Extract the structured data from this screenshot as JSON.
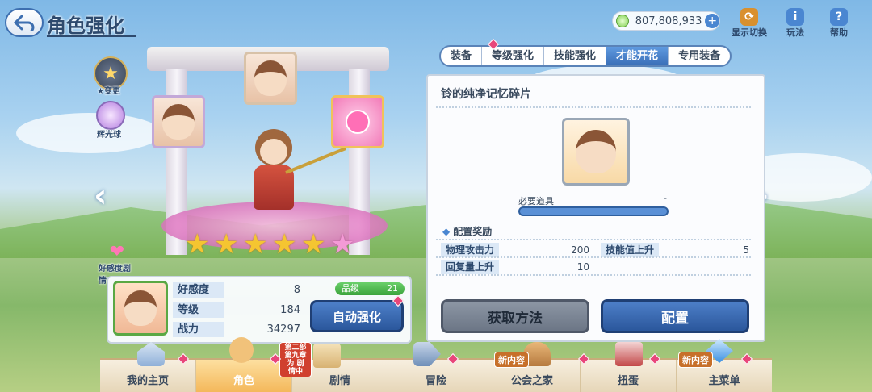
{
  "header": {
    "title": "角色强化",
    "currency_amount": "807,808,933",
    "buttons": [
      {
        "label": "显示切换",
        "icon": "display-toggle-icon"
      },
      {
        "label": "玩法",
        "icon": "info-icon"
      },
      {
        "label": "帮助",
        "icon": "help-icon"
      }
    ]
  },
  "tabs": [
    {
      "label": "装备",
      "active": false
    },
    {
      "label": "等级强化",
      "active": false
    },
    {
      "label": "技能强化",
      "active": false
    },
    {
      "label": "才能开花",
      "active": true
    },
    {
      "label": "专用装备",
      "active": false
    }
  ],
  "side": {
    "star_change_label": "★变更",
    "orb_label": "辉光球",
    "affinity_label": "好感度剧情"
  },
  "character": {
    "star_count": 5,
    "max_stars": 6,
    "stats": [
      {
        "label": "好感度",
        "value": "8"
      },
      {
        "label": "等级",
        "value": "184"
      },
      {
        "label": "战力",
        "value": "34297"
      }
    ],
    "grade_label": "品级",
    "grade_value": "21",
    "auto_button": "自动强化"
  },
  "panel": {
    "title": "铃的纯净记忆碎片",
    "required_label": "必要道具",
    "required_value": "-",
    "reward_header": "配置奖励",
    "rewards": [
      {
        "name": "物理攻击力",
        "value": "200"
      },
      {
        "name": "技能值上升",
        "value": "5"
      },
      {
        "name": "回复量上升",
        "value": "10"
      }
    ],
    "acquire_button": "获取方法",
    "equip_button": "配置"
  },
  "bottom_nav": [
    {
      "label": "我的主页",
      "active": false
    },
    {
      "label": "角色",
      "active": true
    },
    {
      "label": "剧情",
      "active": false,
      "tag": "第二部 第九章为 剧情中"
    },
    {
      "label": "冒险",
      "active": false
    },
    {
      "label": "公会之家",
      "active": false,
      "tag": "新内容"
    },
    {
      "label": "扭蛋",
      "active": false
    },
    {
      "label": "主菜单",
      "active": false,
      "tag": "新内容"
    }
  ],
  "colors": {
    "accent_blue": "#3a6fb8",
    "badge_pink": "#e8467a",
    "star_gold": "#f5c531",
    "star_pink": "#f49ad6"
  }
}
